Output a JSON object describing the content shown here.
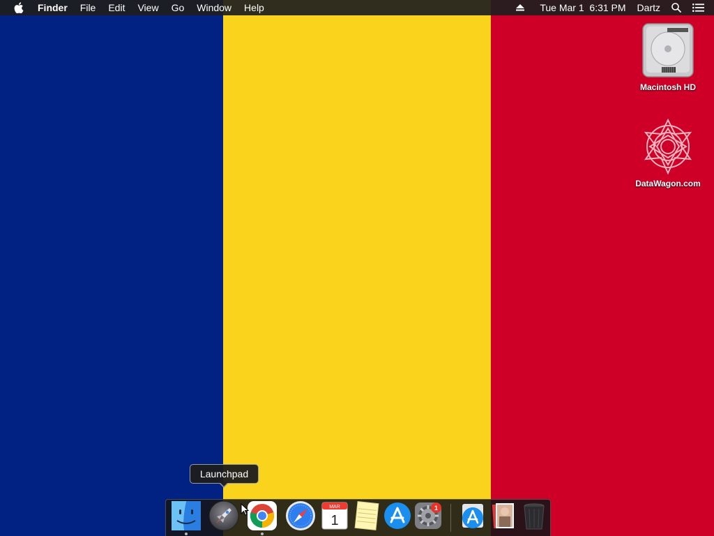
{
  "menubar": {
    "apple_icon": "apple-logo-icon",
    "app_name": "Finder",
    "menus": [
      "File",
      "Edit",
      "View",
      "Go",
      "Window",
      "Help"
    ],
    "eject_icon": "eject-icon",
    "datetime": "Tue Mar 1  6:31 PM",
    "user": "Dartz",
    "spotlight_icon": "magnifying-glass-icon",
    "notification_icon": "list-icon"
  },
  "wallpaper": {
    "colors": [
      "#012282",
      "#fad31d",
      "#cf0027"
    ]
  },
  "desktop_icons": [
    {
      "label": "Macintosh HD",
      "icon": "hard-drive-icon"
    },
    {
      "label": "DataWagon.com",
      "icon": "mandala-pattern-icon"
    }
  ],
  "tooltip": {
    "text": "Launchpad"
  },
  "dock": {
    "apps": [
      {
        "name": "Finder",
        "icon": "finder-icon",
        "running": true
      },
      {
        "name": "Launchpad",
        "icon": "rocket-icon",
        "running": false
      },
      {
        "name": "Google Chrome",
        "icon": "chrome-icon",
        "running": true
      },
      {
        "name": "Safari",
        "icon": "compass-icon",
        "running": false
      },
      {
        "name": "Calendar",
        "icon": "calendar-icon",
        "month": "MAR",
        "day": "1",
        "running": false
      },
      {
        "name": "Notes",
        "icon": "notepad-icon",
        "running": false
      },
      {
        "name": "App Store",
        "icon": "app-store-icon",
        "running": false
      },
      {
        "name": "System Preferences",
        "icon": "gear-icon",
        "badge": "1",
        "running": false
      }
    ],
    "stacks": [
      {
        "name": "Downloads",
        "icon": "app-store-download-icon"
      },
      {
        "name": "Documents",
        "icon": "photo-stack-icon"
      },
      {
        "name": "Trash",
        "icon": "trash-icon"
      }
    ]
  }
}
